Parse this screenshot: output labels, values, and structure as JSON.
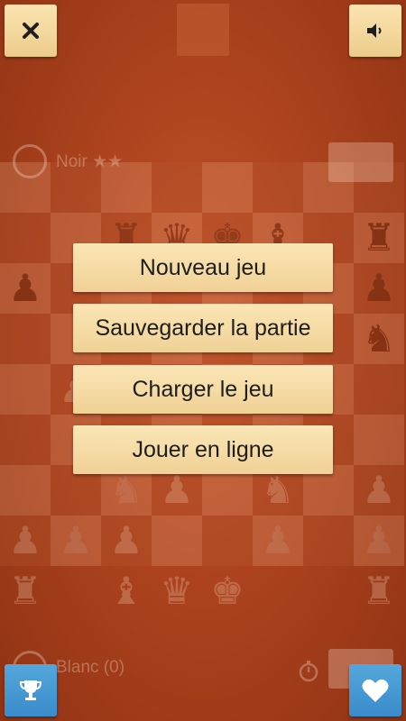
{
  "menu": {
    "items": [
      {
        "label": "Nouveau jeu"
      },
      {
        "label": "Sauvegarder la partie"
      },
      {
        "label": "Charger le jeu"
      },
      {
        "label": "Jouer en ligne"
      }
    ]
  },
  "players": {
    "top": {
      "name": "Noir ★★"
    },
    "bottom": {
      "name": "Blanc (0)"
    }
  },
  "toolbar": {
    "close_icon": "close-icon",
    "sound_icon": "speaker-icon",
    "trophy_icon": "trophy-icon",
    "heart_icon": "heart-icon"
  },
  "colors": {
    "background": "#a8401c",
    "menu_button": "#f5dba4",
    "blue_button": "#4499d4"
  }
}
